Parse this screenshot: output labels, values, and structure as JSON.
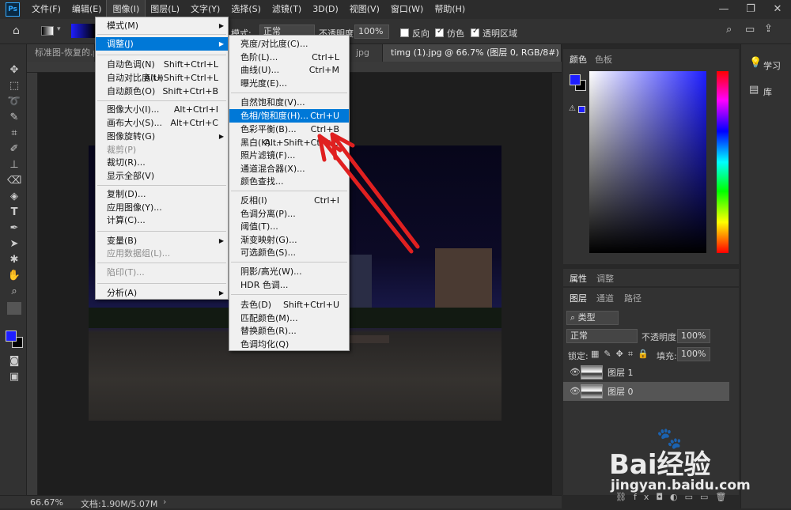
{
  "menubar": {
    "items": [
      "文件(F)",
      "编辑(E)",
      "图像(I)",
      "图层(L)",
      "文字(Y)",
      "选择(S)",
      "滤镜(T)",
      "3D(D)",
      "视图(V)",
      "窗口(W)",
      "帮助(H)"
    ],
    "active": "图像(I)"
  },
  "options": {
    "mode_label": "模式:",
    "mode_value": "正常",
    "opacity_label": "不透明度:",
    "opacity_value": "100%",
    "reverse_label": "反向",
    "dither_label": "仿色",
    "transparency_label": "透明区域"
  },
  "tabs": [
    {
      "label": "标准图-恢复的.ps"
    },
    {
      "label": "jpg"
    },
    {
      "label": "timg (1).jpg @ 66.7% (图层 0, RGB/8#) *"
    }
  ],
  "status": {
    "zoom": "66.67%",
    "doc": "文档:1.90M/5.07M"
  },
  "image_menu": {
    "items": [
      {
        "label": "模式(M)",
        "sub": true
      },
      {
        "label": "调整(J)",
        "sub": true,
        "hl": true
      },
      {
        "label": "自动色调(N)",
        "shortcut": "Shift+Ctrl+L"
      },
      {
        "label": "自动对比度(U)",
        "shortcut": "Alt+Shift+Ctrl+L"
      },
      {
        "label": "自动颜色(O)",
        "shortcut": "Shift+Ctrl+B"
      },
      {
        "label": "图像大小(I)...",
        "shortcut": "Alt+Ctrl+I"
      },
      {
        "label": "画布大小(S)...",
        "shortcut": "Alt+Ctrl+C"
      },
      {
        "label": "图像旋转(G)",
        "sub": true
      },
      {
        "label": "裁剪(P)",
        "dis": true
      },
      {
        "label": "裁切(R)..."
      },
      {
        "label": "显示全部(V)"
      },
      {
        "label": "复制(D)..."
      },
      {
        "label": "应用图像(Y)..."
      },
      {
        "label": "计算(C)..."
      },
      {
        "label": "变量(B)",
        "sub": true
      },
      {
        "label": "应用数据组(L)...",
        "dis": true
      },
      {
        "label": "陷印(T)...",
        "dis": true
      },
      {
        "label": "分析(A)",
        "sub": true
      }
    ]
  },
  "adjust_menu": {
    "items": [
      {
        "label": "亮度/对比度(C)..."
      },
      {
        "label": "色阶(L)...",
        "shortcut": "Ctrl+L"
      },
      {
        "label": "曲线(U)...",
        "shortcut": "Ctrl+M"
      },
      {
        "label": "曝光度(E)..."
      },
      {
        "label": "自然饱和度(V)..."
      },
      {
        "label": "色相/饱和度(H)...",
        "shortcut": "Ctrl+U",
        "hl": true
      },
      {
        "label": "色彩平衡(B)...",
        "shortcut": "Ctrl+B"
      },
      {
        "label": "黑白(K)...",
        "shortcut": "Alt+Shift+Ctrl+B"
      },
      {
        "label": "照片滤镜(F)..."
      },
      {
        "label": "通道混合器(X)..."
      },
      {
        "label": "颜色查找..."
      },
      {
        "label": "反相(I)",
        "shortcut": "Ctrl+I"
      },
      {
        "label": "色调分离(P)..."
      },
      {
        "label": "阈值(T)..."
      },
      {
        "label": "渐变映射(G)..."
      },
      {
        "label": "可选颜色(S)..."
      },
      {
        "label": "阴影/高光(W)..."
      },
      {
        "label": "HDR 色调..."
      },
      {
        "label": "去色(D)",
        "shortcut": "Shift+Ctrl+U"
      },
      {
        "label": "匹配颜色(M)..."
      },
      {
        "label": "替换颜色(R)..."
      },
      {
        "label": "色调均化(Q)"
      }
    ]
  },
  "panels": {
    "color_tab": "颜色",
    "swatch_tab": "色板",
    "props_tab": "属性",
    "adjust_tab": "调整",
    "layers_tab": "图层",
    "channels_tab": "通道",
    "paths_tab": "路径",
    "kind": "类型",
    "blend": "正常",
    "opacity_label": "不透明度:",
    "opacity": "100%",
    "lock_label": "锁定:",
    "fill_label": "填充:",
    "fill": "100%",
    "layers": [
      {
        "name": "图层 1"
      },
      {
        "name": "图层 0"
      }
    ]
  },
  "right_strip": {
    "learn": "学习",
    "library": "库"
  },
  "watermark": {
    "brand": "Bai经验",
    "url": "jingyan.baidu.com"
  },
  "colors": {
    "accent": "#0078d7",
    "fg_swatch": "#1e1eff",
    "bg_swatch": "#000000"
  }
}
